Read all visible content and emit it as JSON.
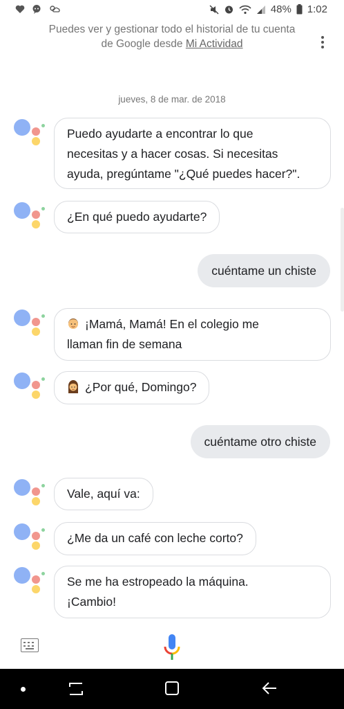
{
  "status_bar": {
    "battery_percent": "48%",
    "time": "1:02",
    "left_icons": [
      "heart-icon",
      "chat-icon",
      "weather-icon"
    ],
    "right_icons": [
      "mute-icon",
      "alarm-icon",
      "wifi-icon",
      "signal-icon",
      "battery-icon"
    ]
  },
  "header": {
    "line1": "Puedes ver y gestionar todo el historial de tu cuenta",
    "line2_prefix": "de Google desde ",
    "link": "Mi Actividad"
  },
  "date": "jueves, 8 de mar. de 2018",
  "messages": [
    {
      "from": "assistant",
      "lines": [
        "Puedo ayudarte a encontrar lo que",
        "necesitas y a hacer cosas. Si necesitas",
        "ayuda, pregúntame \"¿Qué puedes hacer?\"."
      ]
    },
    {
      "from": "assistant",
      "lines": [
        "¿En qué puedo ayudarte?"
      ]
    },
    {
      "from": "user",
      "text": "cuéntame un chiste"
    },
    {
      "from": "assistant",
      "emoji": "boy-emoji",
      "lines": [
        "¡Mamá, Mamá! En el colegio me",
        "llaman fin de semana"
      ]
    },
    {
      "from": "assistant",
      "emoji": "woman-emoji",
      "lines": [
        "¿Por qué, Domingo?"
      ]
    },
    {
      "from": "user",
      "text": "cuéntame otro chiste"
    },
    {
      "from": "assistant",
      "lines": [
        "Vale, aquí va:"
      ]
    },
    {
      "from": "assistant",
      "lines": [
        "¿Me da un café con leche corto?"
      ]
    },
    {
      "from": "assistant",
      "lines": [
        "Se me ha estropeado la máquina.",
        "¡Cambio!"
      ]
    }
  ],
  "colors": {
    "assistant_blue": "#8fb2f5",
    "assistant_red": "#f1968e",
    "assistant_yellow": "#fcd66a",
    "assistant_green": "#8dd39e",
    "user_bubble": "#e8eaed",
    "mic_blue": "#4285f4",
    "mic_red": "#ea4335",
    "mic_yellow": "#fbbc05",
    "mic_green": "#34a853"
  },
  "input_bar": {
    "keyboard_icon": "keyboard-icon",
    "mic_icon": "mic-icon"
  },
  "nav_bar": {
    "icons": [
      "dot-icon",
      "recent-apps-icon",
      "home-icon",
      "back-icon"
    ]
  }
}
